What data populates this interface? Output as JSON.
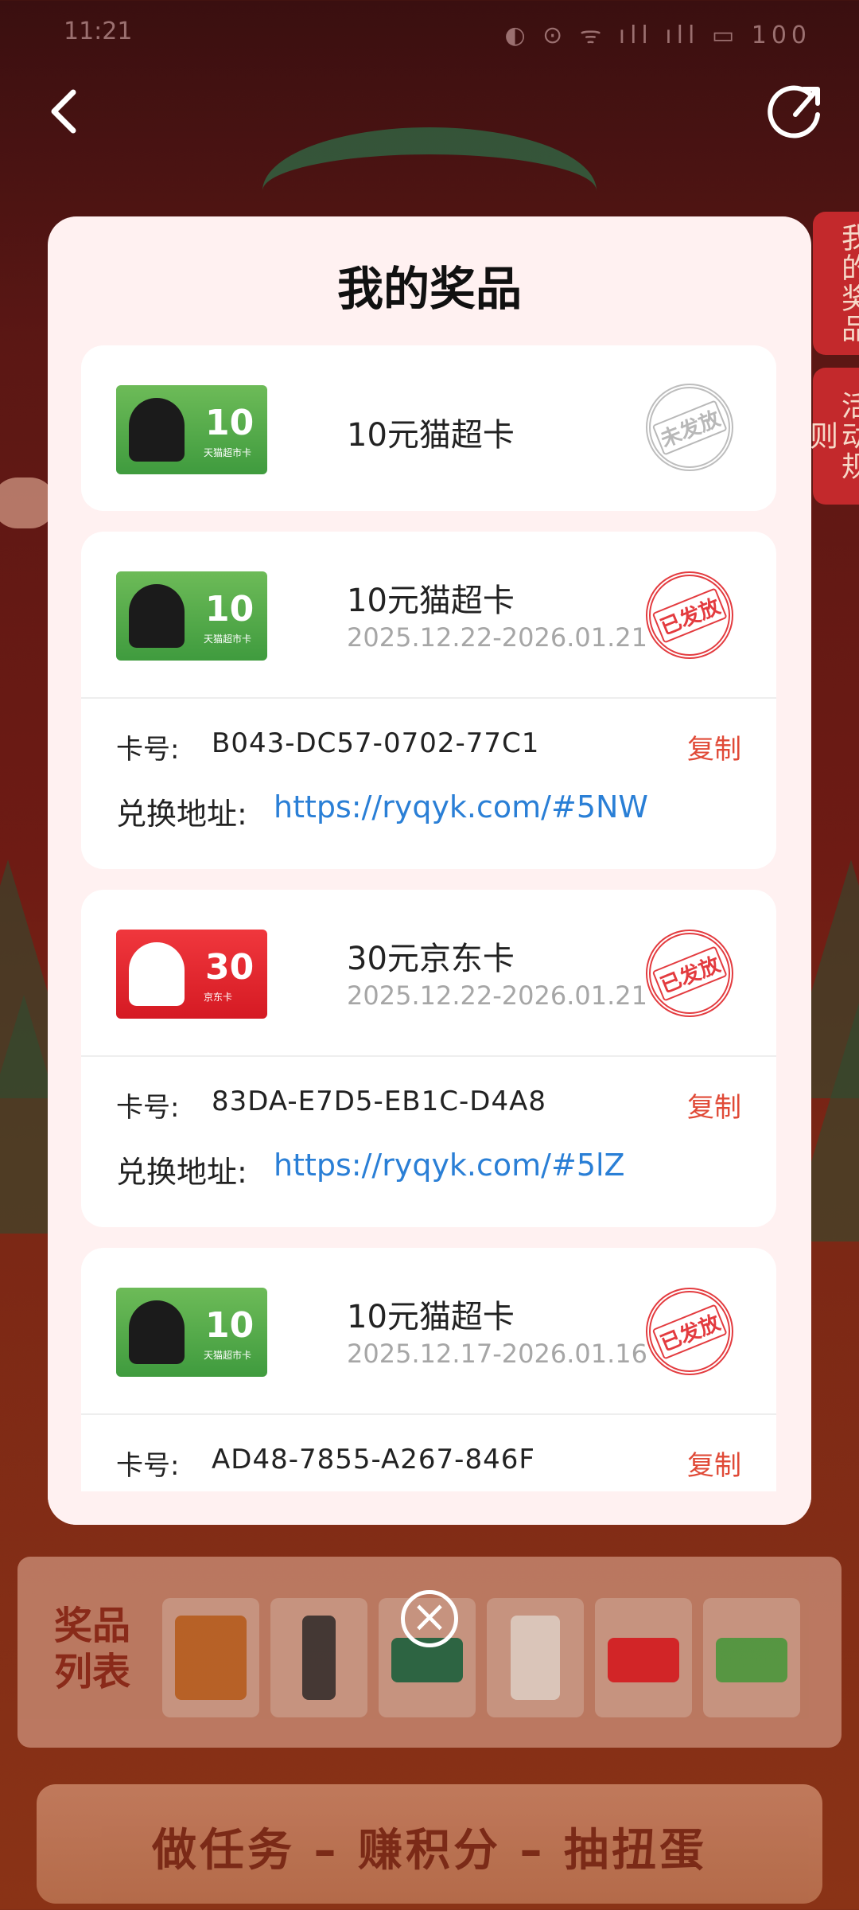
{
  "colors": {
    "accent": "#c3292c",
    "copy": "#e04a37",
    "link": "#2a7fd6",
    "modal_bg": "#fff1f1"
  },
  "status_bar": {
    "time": "11:21",
    "right": "◐ ⊙ ᯤ ıll ıll ▭ 100"
  },
  "nav": {
    "back_icon": "chevron-left-icon",
    "share_icon": "share-icon"
  },
  "side_tabs": {
    "mine": "我的奖品",
    "rules": "活动规则"
  },
  "modal": {
    "title": "我的奖品",
    "labels": {
      "card_no": "卡号:",
      "redeem": "兑换地址:",
      "copy": "复制"
    },
    "items": [
      {
        "name": "10元猫超卡",
        "status": "未发放",
        "card_value": "10",
        "card_sub": "天猫超市卡"
      },
      {
        "name": "10元猫超卡",
        "status": "已发放",
        "date": "2025.12.22-2026.01.21",
        "code": "B043-DC57-0702-77C1",
        "link": "https://ryqyk.com/#5NW",
        "card_value": "10",
        "card_sub": "天猫超市卡"
      },
      {
        "name": "30元京东卡",
        "status": "已发放",
        "date": "2025.12.22-2026.01.21",
        "code": "83DA-E7D5-EB1C-D4A8",
        "link": "https://ryqyk.com/#5lZ",
        "card_value": "30",
        "card_sub": "京东卡"
      },
      {
        "name": "10元猫超卡",
        "status": "已发放",
        "date": "2025.12.17-2026.01.16",
        "code": "AD48-7855-A267-846F",
        "card_value": "10",
        "card_sub": "天猫超市卡"
      }
    ]
  },
  "prize_list": {
    "label": "奖品列表"
  },
  "close_icon": "close-circle-icon",
  "task_button": "做任务 – 赚积分 – 抽扭蛋"
}
